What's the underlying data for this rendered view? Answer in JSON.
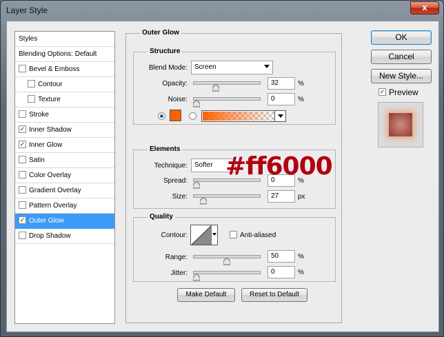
{
  "window": {
    "title": "Layer Style",
    "close_glyph": "x"
  },
  "sidebar": {
    "items": [
      {
        "label": "Styles",
        "checkbox": false,
        "checked": false,
        "indent": 0,
        "active": false
      },
      {
        "label": "Blending Options: Default",
        "checkbox": false,
        "checked": false,
        "indent": 0,
        "active": false
      },
      {
        "label": "Bevel & Emboss",
        "checkbox": true,
        "checked": false,
        "indent": 0,
        "active": false
      },
      {
        "label": "Contour",
        "checkbox": true,
        "checked": false,
        "indent": 1,
        "active": false
      },
      {
        "label": "Texture",
        "checkbox": true,
        "checked": false,
        "indent": 1,
        "active": false
      },
      {
        "label": "Stroke",
        "checkbox": true,
        "checked": false,
        "indent": 0,
        "active": false
      },
      {
        "label": "Inner Shadow",
        "checkbox": true,
        "checked": true,
        "indent": 0,
        "active": false
      },
      {
        "label": "Inner Glow",
        "checkbox": true,
        "checked": true,
        "indent": 0,
        "active": false
      },
      {
        "label": "Satin",
        "checkbox": true,
        "checked": false,
        "indent": 0,
        "active": false
      },
      {
        "label": "Color Overlay",
        "checkbox": true,
        "checked": false,
        "indent": 0,
        "active": false
      },
      {
        "label": "Gradient Overlay",
        "checkbox": true,
        "checked": false,
        "indent": 0,
        "active": false
      },
      {
        "label": "Pattern Overlay",
        "checkbox": true,
        "checked": false,
        "indent": 0,
        "active": false
      },
      {
        "label": "Outer Glow",
        "checkbox": true,
        "checked": true,
        "indent": 0,
        "active": true
      },
      {
        "label": "Drop Shadow",
        "checkbox": true,
        "checked": false,
        "indent": 0,
        "active": false
      }
    ]
  },
  "panel": {
    "title": "Outer Glow",
    "structure": {
      "title": "Structure",
      "blend_mode_label": "Blend Mode:",
      "blend_mode_value": "Screen",
      "opacity_label": "Opacity:",
      "opacity_value": "32",
      "opacity_level": 0.32,
      "noise_label": "Noise:",
      "noise_value": "0",
      "noise_level": 0,
      "percent": "%",
      "glow_color": "#ff6000"
    },
    "elements": {
      "title": "Elements",
      "technique_label": "Technique:",
      "technique_value": "Softer",
      "spread_label": "Spread:",
      "spread_value": "0",
      "spread_level": 0,
      "size_label": "Size:",
      "size_value": "27",
      "size_level": 0.108,
      "percent": "%",
      "px": "px"
    },
    "quality": {
      "title": "Quality",
      "contour_label": "Contour:",
      "anti_aliased_label": "Anti-aliased",
      "range_label": "Range:",
      "range_value": "50",
      "range_level": 0.5,
      "jitter_label": "Jitter:",
      "jitter_value": "0",
      "jitter_level": 0,
      "percent": "%"
    },
    "make_default_label": "Make Default",
    "reset_default_label": "Reset to Default"
  },
  "buttons": {
    "ok_label": "OK",
    "cancel_label": "Cancel",
    "new_style_label": "New Style...",
    "preview_label": "Preview",
    "preview_checked": true
  },
  "annotation": {
    "text": "#ff6000",
    "color": "#b10012"
  }
}
